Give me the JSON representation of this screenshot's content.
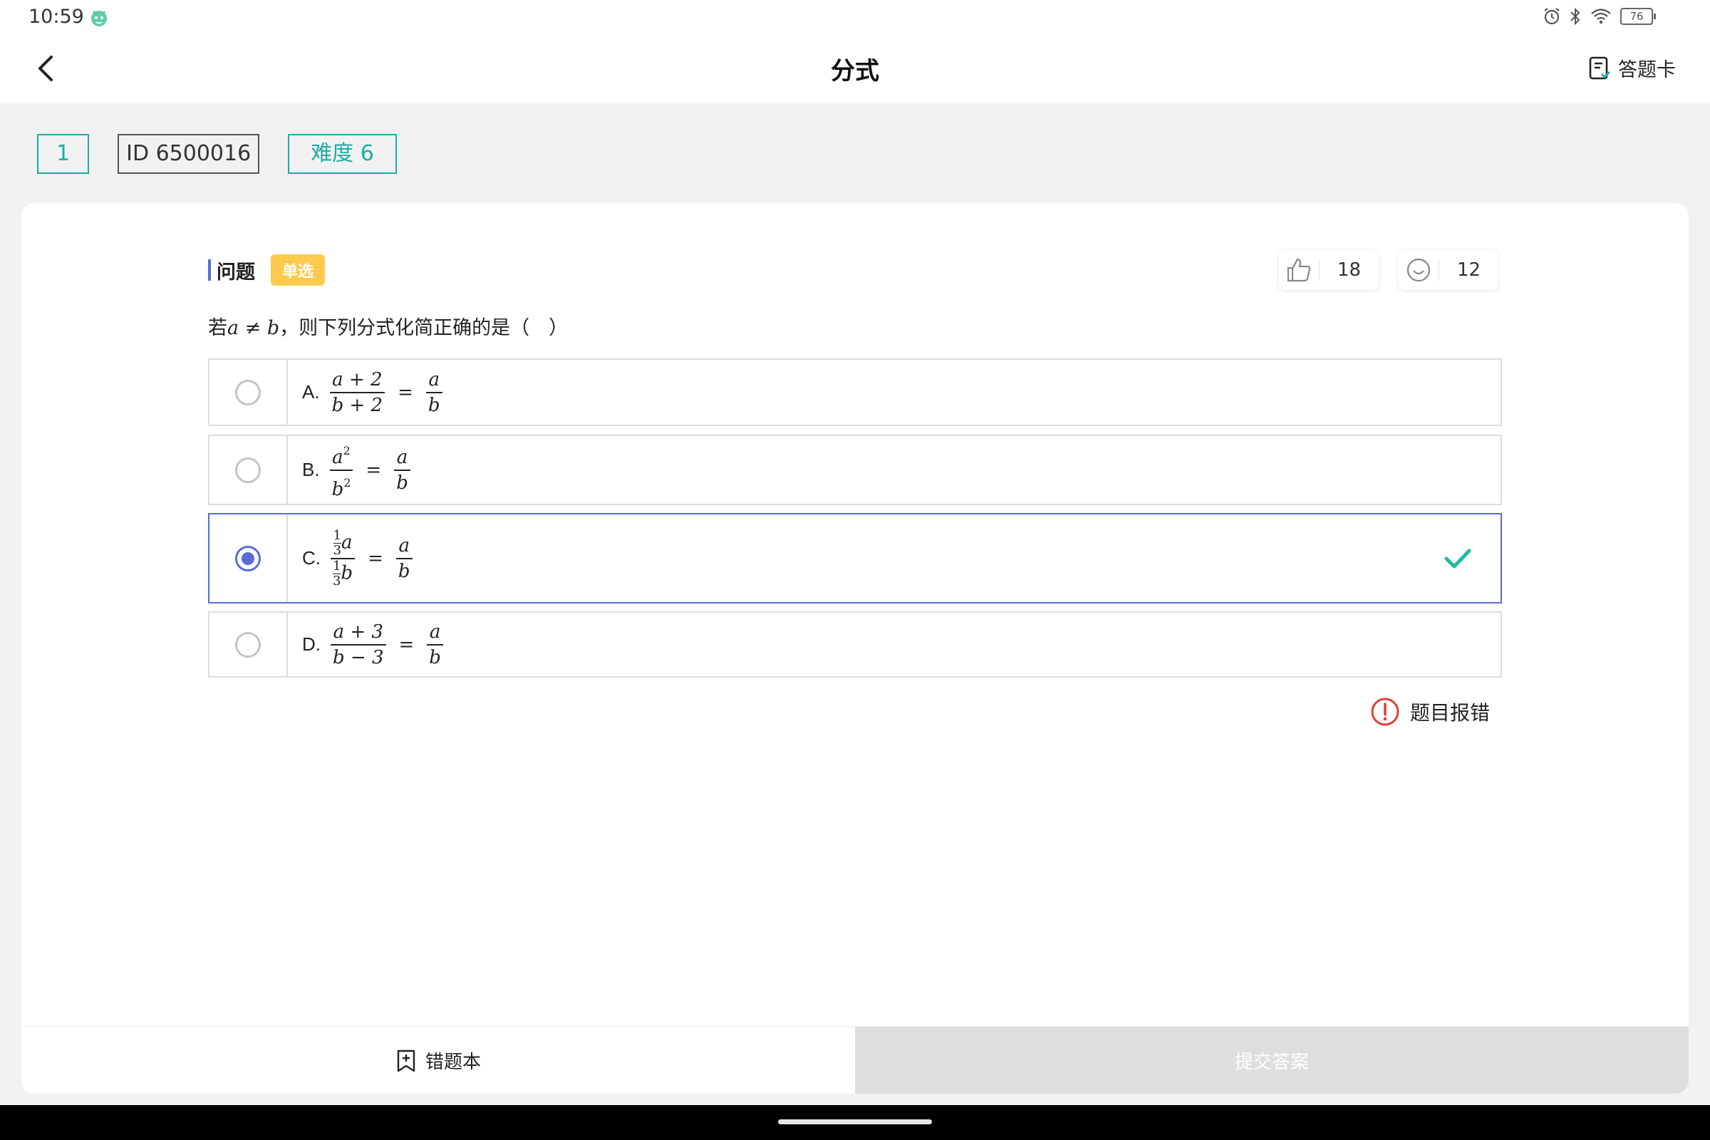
{
  "status_bar": {
    "time": "10:59",
    "battery_level": "76",
    "icons": [
      "alarm-icon",
      "bluetooth-icon",
      "wifi-icon",
      "battery-icon"
    ]
  },
  "nav": {
    "title": "分式",
    "answer_card_label": "答题卡"
  },
  "tags": {
    "number": "1",
    "id": "ID 6500016",
    "difficulty": "难度 6"
  },
  "question": {
    "label": "问题",
    "type_badge": "单选",
    "likes": "18",
    "smiles": "12",
    "stem_prefix": "若",
    "stem_math": "a ≠ b",
    "stem_suffix": "，则下列分式化简正确的是（　）"
  },
  "options": [
    {
      "letter": "A.",
      "lhs_num": "a + 2",
      "lhs_den": "b + 2",
      "rhs_num": "a",
      "rhs_den": "b",
      "selected": false
    },
    {
      "letter": "B.",
      "lhs_num": "a",
      "lhs_num_sup": "2",
      "lhs_den": "b",
      "lhs_den_sup": "2",
      "rhs_num": "a",
      "rhs_den": "b",
      "selected": false
    },
    {
      "letter": "C.",
      "mini_num": "1",
      "mini_den": "3",
      "lhs_num_var": "a",
      "lhs_den_var": "b",
      "rhs_num": "a",
      "rhs_den": "b",
      "selected": true,
      "correct": true
    },
    {
      "letter": "D.",
      "lhs_num": "a + 3",
      "lhs_den": "b − 3",
      "rhs_num": "a",
      "rhs_den": "b",
      "selected": false
    }
  ],
  "report_label": "题目报错",
  "bottom": {
    "wrong_book_label": "错题本",
    "submit_label": "提交答案"
  },
  "colors": {
    "accent_teal": "#1aaea5",
    "selected_blue": "#5b6cd6",
    "badge_yellow": "#ffc94d",
    "report_red": "#e0403a",
    "check_green": "#1dbb9e"
  }
}
